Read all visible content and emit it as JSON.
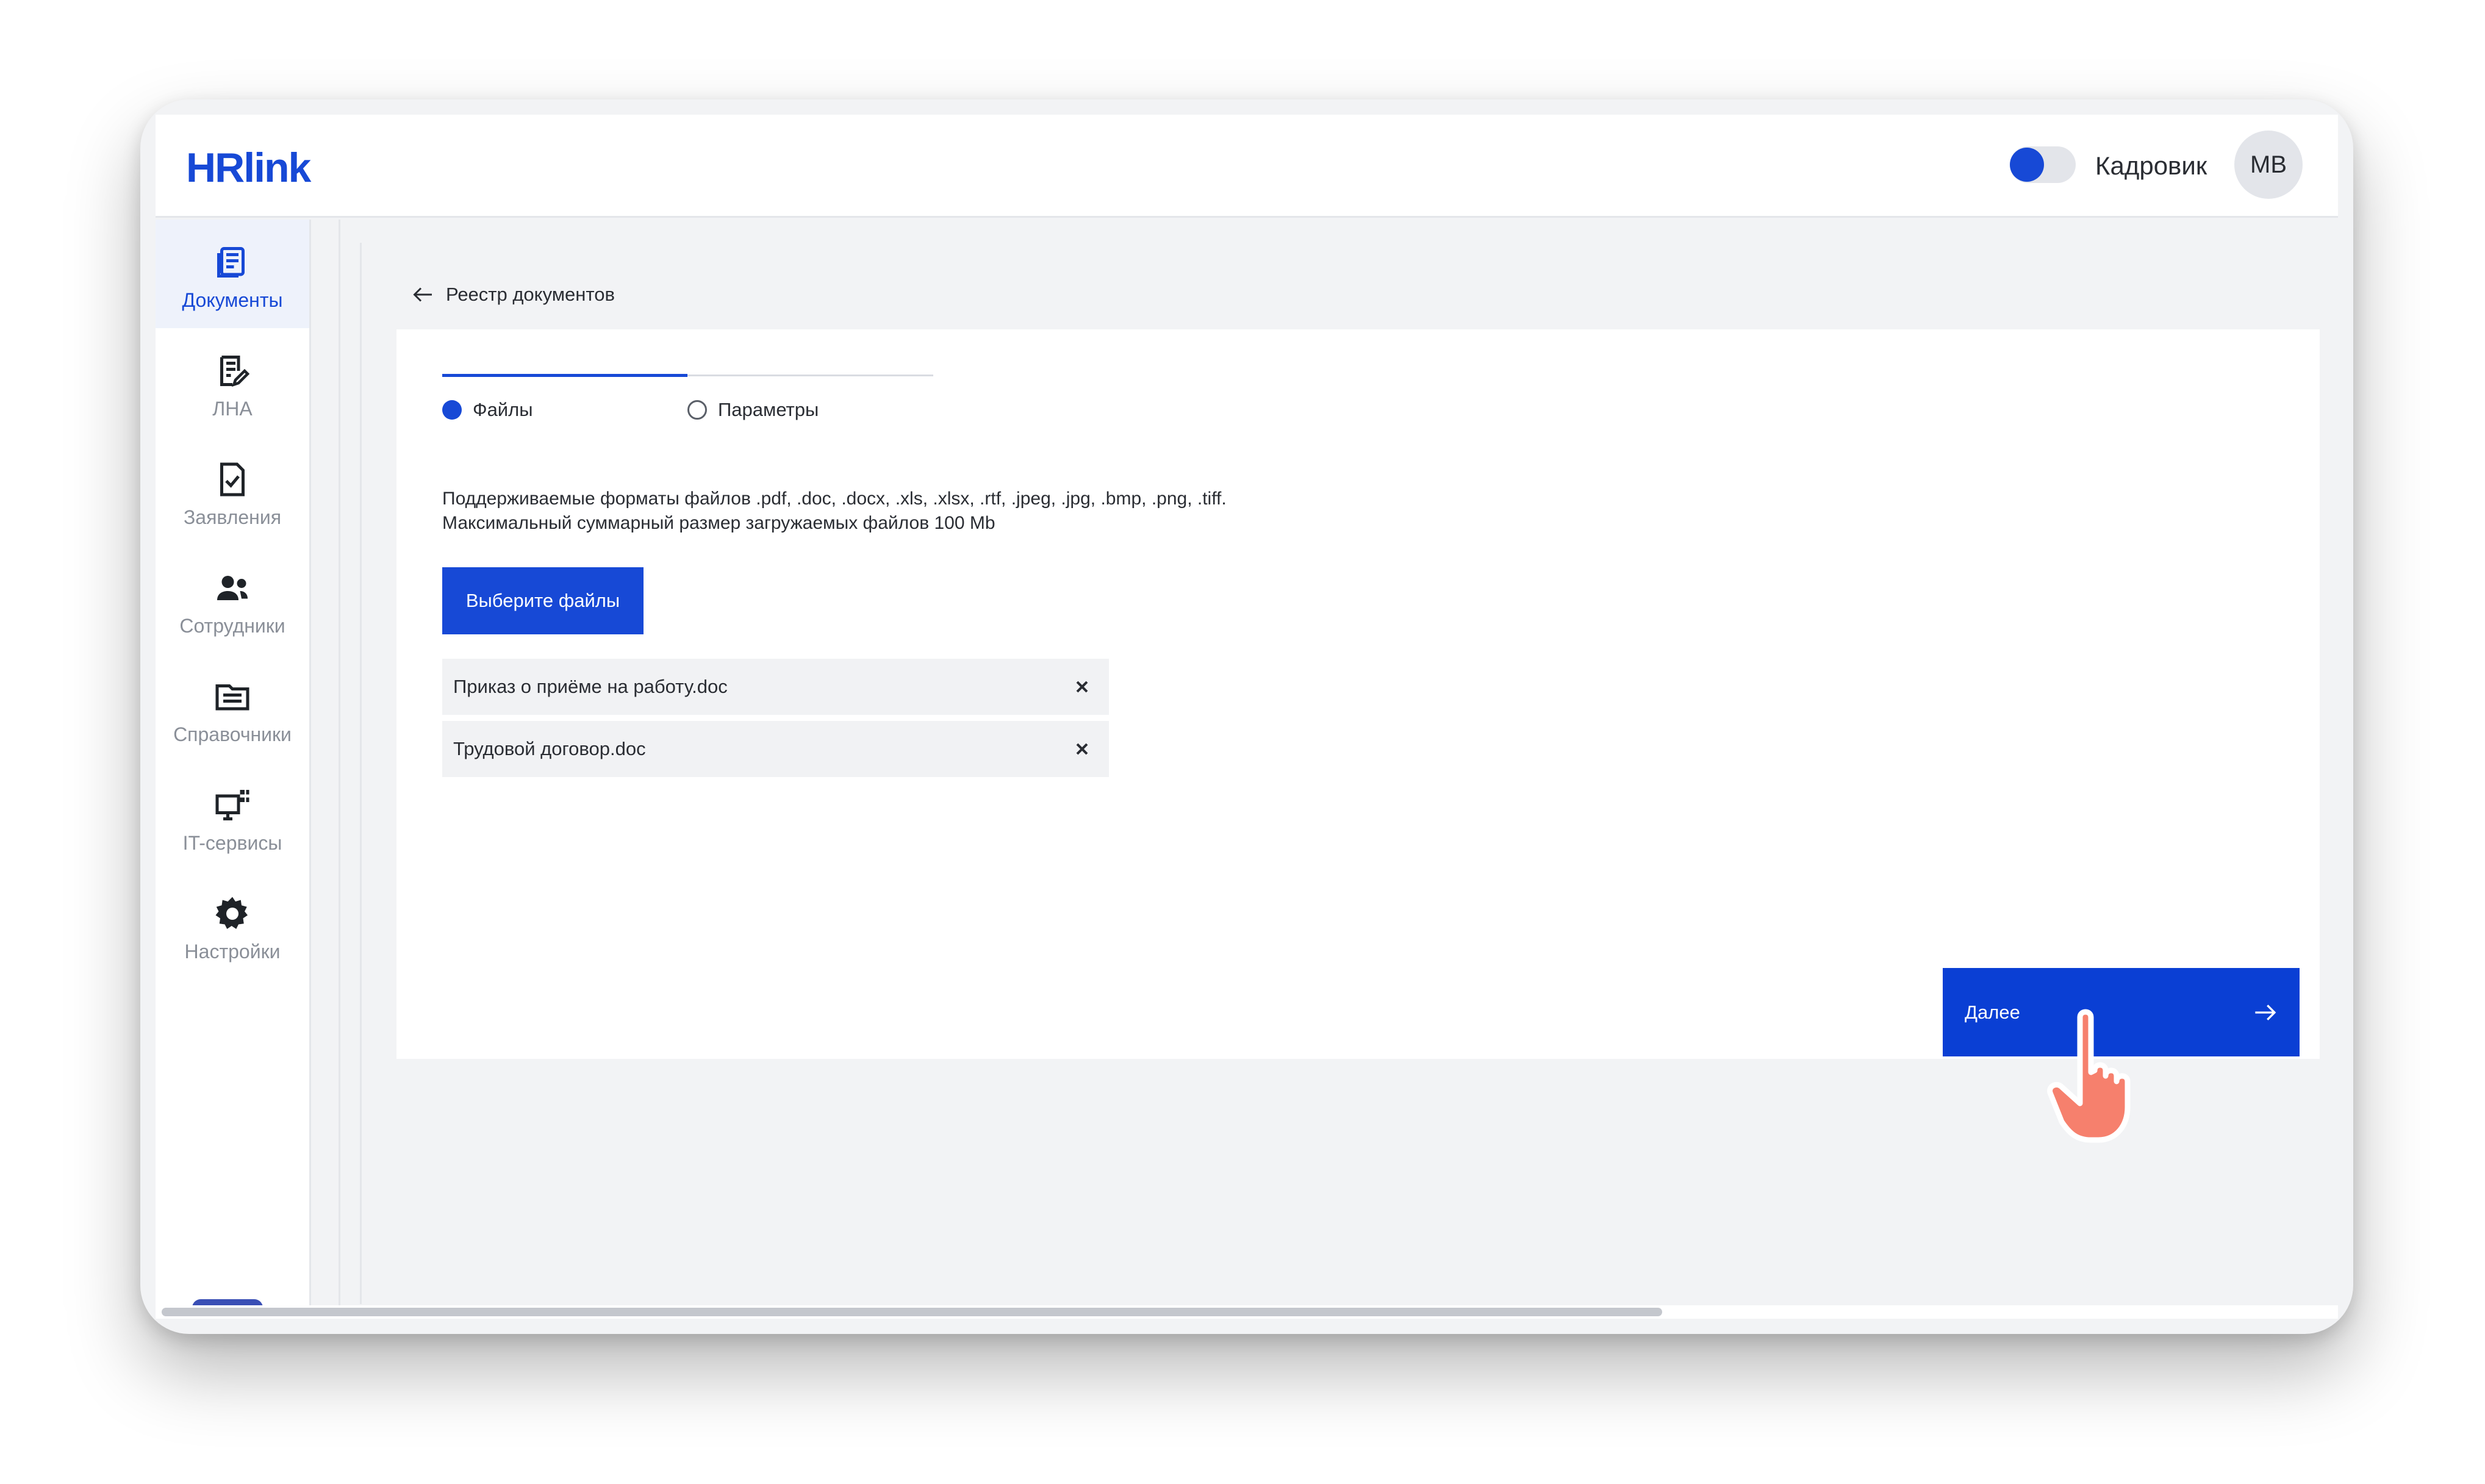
{
  "app": {
    "logo_text": "HRlink",
    "brand_color": "#1749d6"
  },
  "header": {
    "role_label": "Кадровик",
    "avatar_initials": "MB",
    "toggle_on": true
  },
  "sidebar": {
    "items": [
      {
        "label": "Документы",
        "icon": "documents-icon",
        "active": true
      },
      {
        "label": "ЛНА",
        "icon": "edit-document-icon",
        "active": false
      },
      {
        "label": "Заявления",
        "icon": "checked-file-icon",
        "active": false
      },
      {
        "label": "Сотрудники",
        "icon": "users-icon",
        "active": false
      },
      {
        "label": "Справочники",
        "icon": "folder-icon",
        "active": false
      },
      {
        "label": "IT-сервисы",
        "icon": "monitor-apps-icon",
        "active": false
      },
      {
        "label": "Настройки",
        "icon": "gear-icon",
        "active": false
      }
    ],
    "help_label": "?"
  },
  "breadcrumb": {
    "back_label": "Реестр документов"
  },
  "wizard": {
    "steps": [
      {
        "label": "Файлы",
        "active": true
      },
      {
        "label": "Параметры",
        "active": false
      }
    ],
    "info_line1": "Поддерживаемые форматы файлов .pdf, .doc, .docx, .xls, .xlsx, .rtf, .jpeg, .jpg, .bmp, .png, .tiff.",
    "info_line2": "Максимальный суммарный размер загружаемых файлов 100 Mb",
    "choose_files_label": "Выберите файлы",
    "files": [
      {
        "name": "Приказ о приёме на работу.doc"
      },
      {
        "name": "Трудовой договор.doc"
      }
    ],
    "next_label": "Далее"
  }
}
